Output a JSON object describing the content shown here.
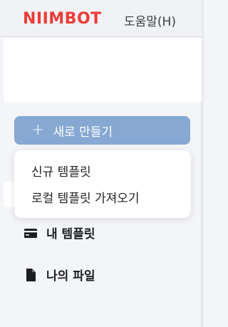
{
  "header": {
    "logo_text": "NIIMBOT",
    "help_label": "도움말(H)"
  },
  "new_button": {
    "label": "새로 만들기",
    "icon": "plus-icon"
  },
  "dropdown": {
    "items": [
      {
        "label": "신규 템플릿"
      },
      {
        "label": "로컬 템플릿 가져오기"
      }
    ]
  },
  "nav": {
    "items": [
      {
        "label": "내 템플릿",
        "icon": "card-icon"
      },
      {
        "label": "나의 파일",
        "icon": "file-icon"
      }
    ]
  },
  "colors": {
    "brand": "#f03c38",
    "button": "#86a8d2"
  }
}
